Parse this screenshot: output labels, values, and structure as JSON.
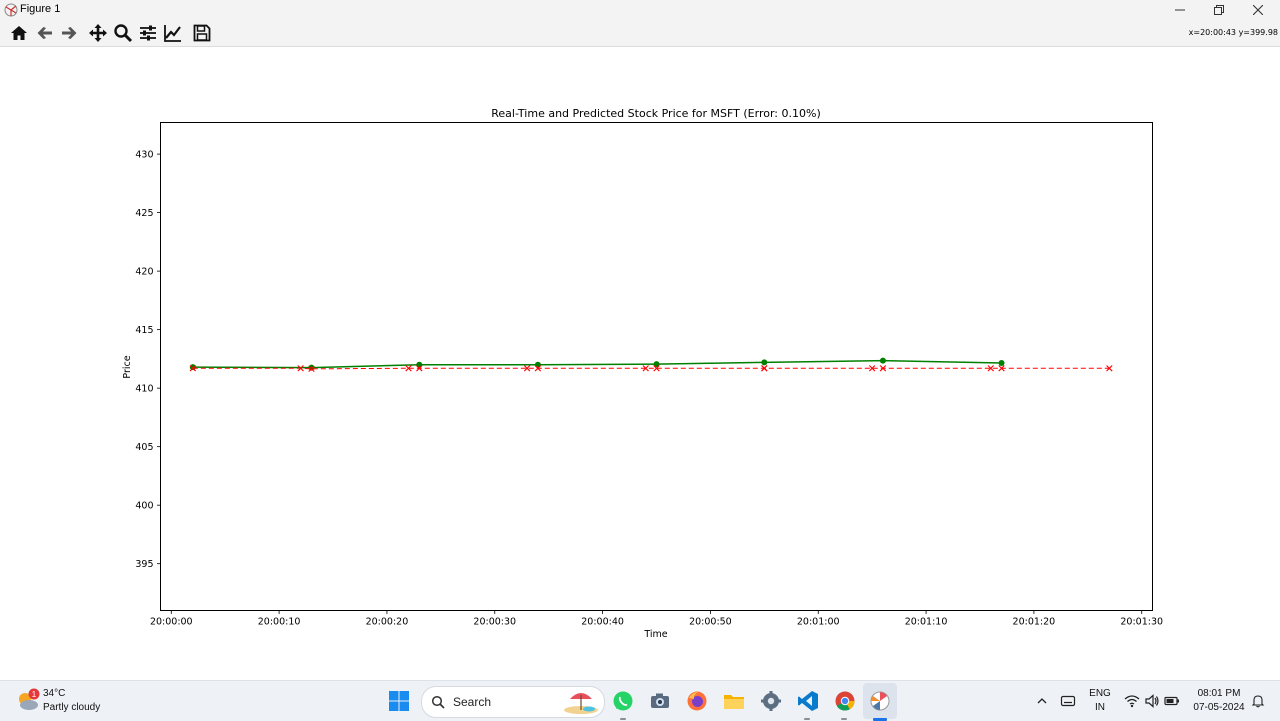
{
  "window": {
    "title": "Figure 1",
    "controls": [
      "minimize-icon",
      "restore-icon",
      "close-icon"
    ]
  },
  "toolbar": {
    "tools": [
      "home-icon",
      "back-icon",
      "forward-icon",
      "pan-icon",
      "zoom-icon",
      "configure-subplots-icon",
      "edit-axis-icon",
      "save-icon"
    ],
    "coords": "x=20:00:43 y=399.98"
  },
  "chart_data": {
    "type": "line",
    "title": "Real-Time and Predicted Stock Price for MSFT (Error: 0.10%)",
    "xlabel": "Time",
    "ylabel": "Price",
    "x_range": [
      "19:59:59",
      "20:01:31"
    ],
    "ylim": [
      391,
      432.7
    ],
    "y_ticks": [
      395,
      400,
      405,
      410,
      415,
      420,
      425,
      430
    ],
    "x_ticks": [
      "20:00:00",
      "20:00:10",
      "20:00:20",
      "20:00:30",
      "20:00:40",
      "20:00:50",
      "20:01:00",
      "20:01:10",
      "20:01:20",
      "20:01:30"
    ],
    "grid": false,
    "legend": null,
    "series": [
      {
        "marker": "o",
        "linestyle": "solid",
        "color": "#008000",
        "points": [
          {
            "x": "20:00:02",
            "y": 411.8
          },
          {
            "x": "20:00:13",
            "y": 411.75
          },
          {
            "x": "20:00:23",
            "y": 412.0
          },
          {
            "x": "20:00:34",
            "y": 412.0
          },
          {
            "x": "20:00:45",
            "y": 412.05
          },
          {
            "x": "20:00:55",
            "y": 412.2
          },
          {
            "x": "20:01:06",
            "y": 412.35
          },
          {
            "x": "20:01:17",
            "y": 412.15
          }
        ]
      },
      {
        "marker": "x",
        "linestyle": "dashed",
        "color": "#ff0000",
        "points": [
          {
            "x": "20:00:02",
            "y": 411.7
          },
          {
            "x": "20:00:12",
            "y": 411.7
          },
          {
            "x": "20:00:13",
            "y": 411.65
          },
          {
            "x": "20:00:22",
            "y": 411.7
          },
          {
            "x": "20:00:23",
            "y": 411.7
          },
          {
            "x": "20:00:33",
            "y": 411.7
          },
          {
            "x": "20:00:34",
            "y": 411.7
          },
          {
            "x": "20:00:44",
            "y": 411.7
          },
          {
            "x": "20:00:45",
            "y": 411.7
          },
          {
            "x": "20:00:55",
            "y": 411.7
          },
          {
            "x": "20:00:55",
            "y": 411.7
          },
          {
            "x": "20:01:05",
            "y": 411.7
          },
          {
            "x": "20:01:06",
            "y": 411.7
          },
          {
            "x": "20:01:16",
            "y": 411.7
          },
          {
            "x": "20:01:17",
            "y": 411.7
          },
          {
            "x": "20:01:27",
            "y": 411.7
          }
        ]
      }
    ]
  },
  "taskbar": {
    "weather": {
      "temp": "34°C",
      "desc": "Partly cloudy",
      "badge": "1"
    },
    "search_label": "Search",
    "apps": [
      "windows-start-icon",
      "search-icon",
      "beach-widget-icon",
      "whatsapp-icon",
      "camera-icon",
      "firefox-icon",
      "file-explorer-icon",
      "settings-icon",
      "vscode-icon",
      "chrome-icon",
      "python-figure-icon"
    ],
    "tray": {
      "lang_top": "ENG",
      "lang_bottom": "IN",
      "time": "08:01 PM",
      "date": "07-05-2024"
    }
  }
}
